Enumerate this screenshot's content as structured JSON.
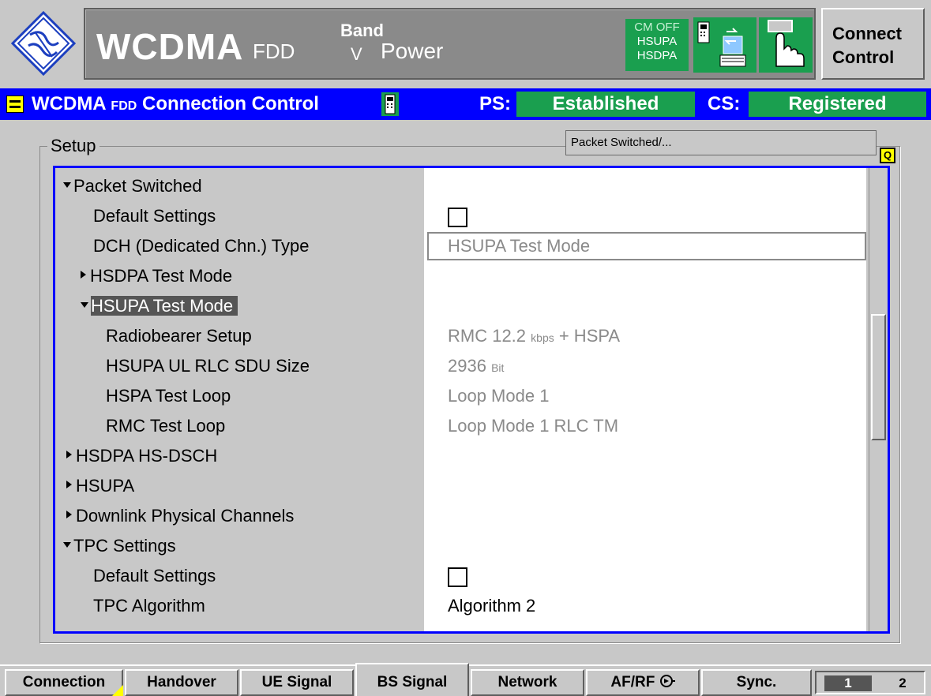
{
  "header": {
    "title_main": "WCDMA",
    "title_fdd": "FDD",
    "band_label": "Band",
    "band_value": "V",
    "mode": "Power",
    "status_cm": "CM OFF",
    "status_hsupa": "HSUPA",
    "status_hsdpa": "HSDPA",
    "connect_line1": "Connect",
    "connect_line2": "Control"
  },
  "statusbar": {
    "title": "WCDMA",
    "title_small": "FDD",
    "title_rest": "Connection Control",
    "ps_label": "PS:",
    "ps_value": "Established",
    "cs_label": "CS:",
    "cs_value": "Registered"
  },
  "setup": {
    "legend": "Setup",
    "path": "Packet Switched/..."
  },
  "tree": {
    "packet_switched": "Packet Switched",
    "default_settings": "Default Settings",
    "dch_type": "DCH (Dedicated Chn.) Type",
    "dch_type_value": "HSUPA Test Mode",
    "hsdpa_test_mode": "HSDPA Test Mode",
    "hsupa_test_mode": "HSUPA Test Mode",
    "radiobearer_setup": "Radiobearer Setup",
    "radiobearer_value_a": "RMC 12.2 ",
    "radiobearer_value_unit": "kbps",
    "radiobearer_value_b": " + HSPA",
    "sdu_size": "HSUPA UL RLC SDU Size",
    "sdu_value": "2936 ",
    "sdu_unit": "Bit",
    "hspa_test_loop": "HSPA Test Loop",
    "hspa_test_loop_value": "Loop Mode 1",
    "rmc_test_loop": "RMC Test Loop",
    "rmc_test_loop_value": "Loop Mode 1 RLC TM",
    "hsdpa_hsdsch": "HSDPA HS-DSCH",
    "hsupa": "HSUPA",
    "downlink_phys": "Downlink Physical Channels",
    "tpc_settings": "TPC Settings",
    "tpc_default_settings": "Default Settings",
    "tpc_algorithm": "TPC Algorithm",
    "tpc_algorithm_value": "Algorithm 2"
  },
  "tabs": {
    "connection": "Connection",
    "handover": "Handover",
    "ue_signal": "UE Signal",
    "bs_signal": "BS Signal",
    "network": "Network",
    "afrf": "AF/RF",
    "sync": "Sync.",
    "page1": "1",
    "page2": "2"
  },
  "colors": {
    "status_bar": "#0000ff",
    "status_green": "#1a9f4f",
    "highlight_yellow": "#ffff00"
  },
  "icons": [
    "rs-logo-icon",
    "phone-icon",
    "hand-icon",
    "menu-icon",
    "q-icon",
    "afrf-connector-icon"
  ]
}
